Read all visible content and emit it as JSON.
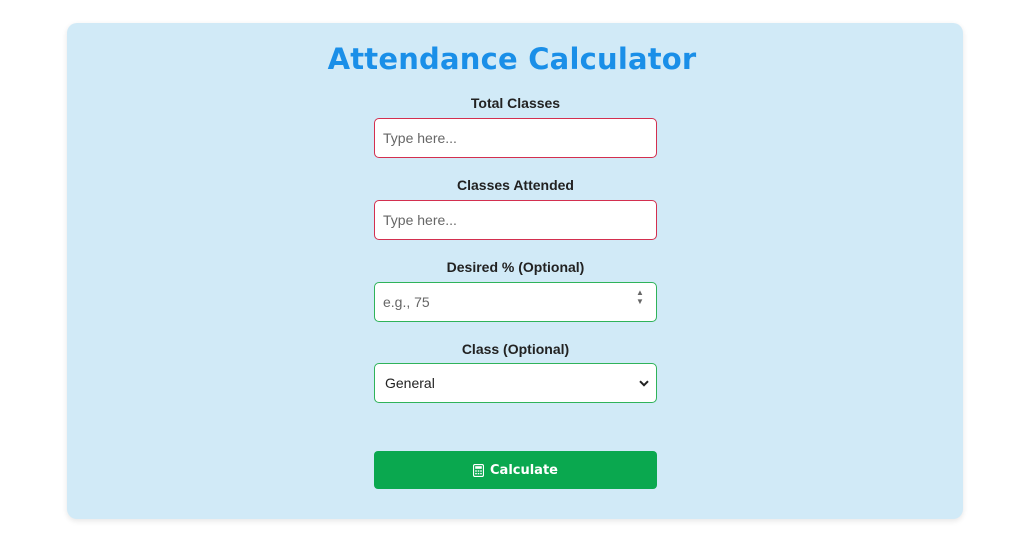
{
  "title": "Attendance Calculator",
  "fields": {
    "total_classes": {
      "label": "Total Classes",
      "placeholder": "Type here...",
      "value": ""
    },
    "classes_attended": {
      "label": "Classes Attended",
      "placeholder": "Type here...",
      "value": ""
    },
    "desired_percent": {
      "label": "Desired % (Optional)",
      "placeholder": "e.g., 75",
      "value": ""
    },
    "class": {
      "label": "Class (Optional)",
      "selected": "General"
    }
  },
  "button": {
    "label": "Calculate",
    "icon": "calculator-icon"
  },
  "colors": {
    "background": "#ffffff",
    "card": "#d1eaf7",
    "title": "#1a8fe8",
    "required_border": "#d32f4f",
    "optional_border": "#2fb35a",
    "button": "#0aa84f"
  }
}
